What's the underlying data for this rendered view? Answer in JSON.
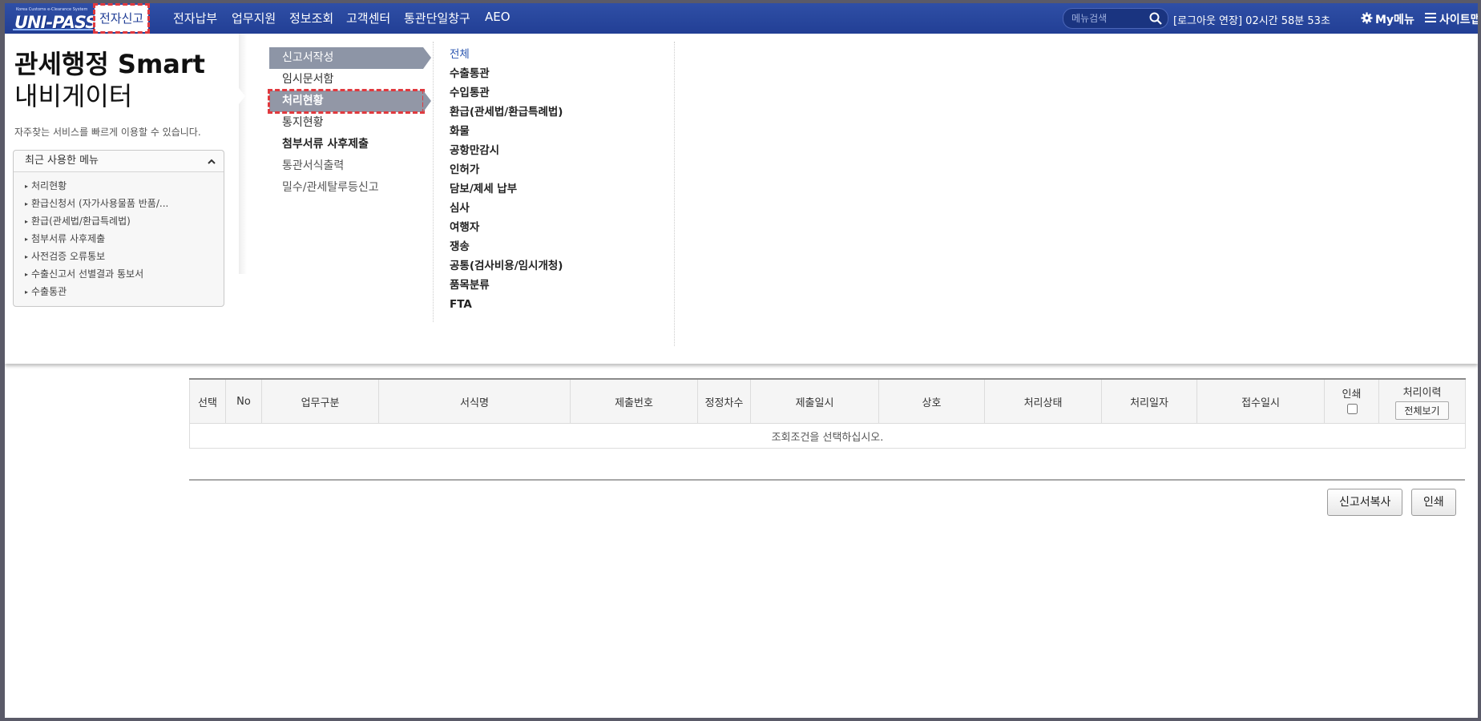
{
  "logo": {
    "subtitle": "Korea Customs e-Clearance System",
    "text": "UNI-PASS"
  },
  "topnav": {
    "items": [
      "전자신고",
      "전자납부",
      "업무지원",
      "정보조회",
      "고객센터",
      "통관단일창구",
      "AEO"
    ],
    "active_index": 0
  },
  "search": {
    "placeholder": "메뉴검색"
  },
  "session": {
    "text": "[로그아웃 연장] 02시간 58분 53초"
  },
  "mymenu": {
    "label": "My메뉴"
  },
  "sitemap": {
    "label": "사이트맵"
  },
  "navigator": {
    "title_line1": "관세행정 Smart",
    "title_line2": "내비게이터",
    "description": "자주찾는 서비스를 빠르게 이용할 수 있습니다.",
    "recent_header": "최근 사용한 메뉴",
    "recent_items": [
      "처리현황",
      "환급신청서 (자가사용물품 반품/...",
      "환급(관세법/환급특례법)",
      "첨부서류 사후제출",
      "사전검증 오류통보",
      "수출신고서 선별결과 통보서",
      "수출통관"
    ]
  },
  "submenu": {
    "items": [
      "신고서작성",
      "임시문서함",
      "처리현황",
      "통지현황",
      "첨부서류 사후제출",
      "통관서식출력",
      "밀수/관세탈루등신고"
    ],
    "selected": "신고서작성",
    "hovered": "처리현황"
  },
  "categories": [
    "전체",
    "수출통관",
    "수입통관",
    "환급(관세법/환급특례법)",
    "화물",
    "공항만감시",
    "인허가",
    "담보/제세 납부",
    "심사",
    "여행자",
    "쟁송",
    "공통(검사비용/임시개청)",
    "품목분류",
    "FTA"
  ],
  "table": {
    "headers": [
      "선택",
      "No",
      "업무구분",
      "서식명",
      "제출번호",
      "정정차수",
      "제출일시",
      "상호",
      "처리상태",
      "처리일자",
      "접수일시",
      "인쇄",
      "처리이력"
    ],
    "view_all_button": "전체보기",
    "empty_message": "조회조건을 선택하십시오."
  },
  "actions": {
    "copy_button": "신고서복사",
    "print_button": "인쇄"
  },
  "colors": {
    "topbar": "#223f95",
    "selected_menu": "#8d95a6",
    "highlight_outline": "#e0393e"
  }
}
